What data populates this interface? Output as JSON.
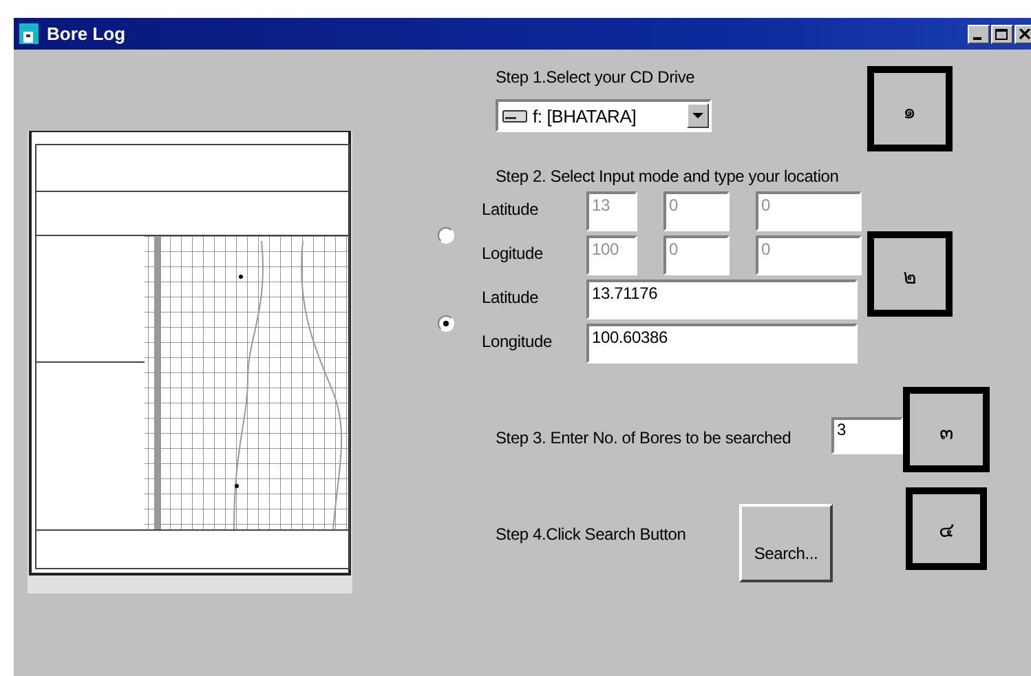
{
  "window": {
    "title": "Bore Log"
  },
  "step1": {
    "label": "Step 1.Select your CD Drive",
    "drive": "f: [BHATARA]",
    "marker": "๑"
  },
  "step2": {
    "label": "Step 2. Select Input mode and type your location",
    "marker": "๒",
    "modes": [
      {
        "selected": false,
        "rows": [
          {
            "label": "Latitude",
            "fields": [
              "13",
              "0",
              "0"
            ]
          },
          {
            "label": "Logitude",
            "fields": [
              "100",
              "0",
              "0"
            ]
          }
        ]
      },
      {
        "selected": true,
        "rows": [
          {
            "label": "Latitude",
            "fields": [
              "13.71176"
            ]
          },
          {
            "label": "Longitude",
            "fields": [
              "100.60386"
            ]
          }
        ]
      }
    ]
  },
  "step3": {
    "label": "Step 3. Enter No. of Bores to be searched",
    "value": "3",
    "marker": "๓"
  },
  "step4": {
    "label": "Step 4.Click Search Button",
    "button": "Search...",
    "marker": "๔"
  }
}
